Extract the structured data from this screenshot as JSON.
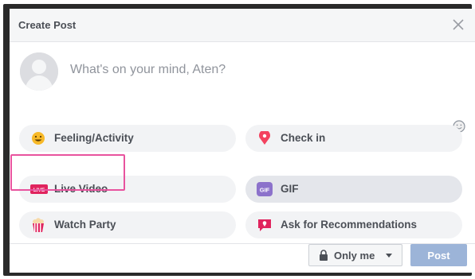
{
  "header": {
    "title": "Create Post"
  },
  "composer": {
    "placeholder": "What's on your mind, Aten?"
  },
  "options": {
    "feeling": "Feeling/Activity",
    "checkin": "Check in",
    "live": "Live Video",
    "live_badge": "LIVE",
    "gif": "GIF",
    "gif_badge": "GIF",
    "watch_party": "Watch Party",
    "recommendations": "Ask for Recommendations"
  },
  "footer": {
    "privacy": "Only me",
    "post": "Post"
  },
  "colors": {
    "highlight": "#e8539e",
    "post_button": "#9cb4d8",
    "live_red": "#e0245e",
    "gif_purple": "#8c72cb",
    "checkin_red": "#f3425f"
  }
}
